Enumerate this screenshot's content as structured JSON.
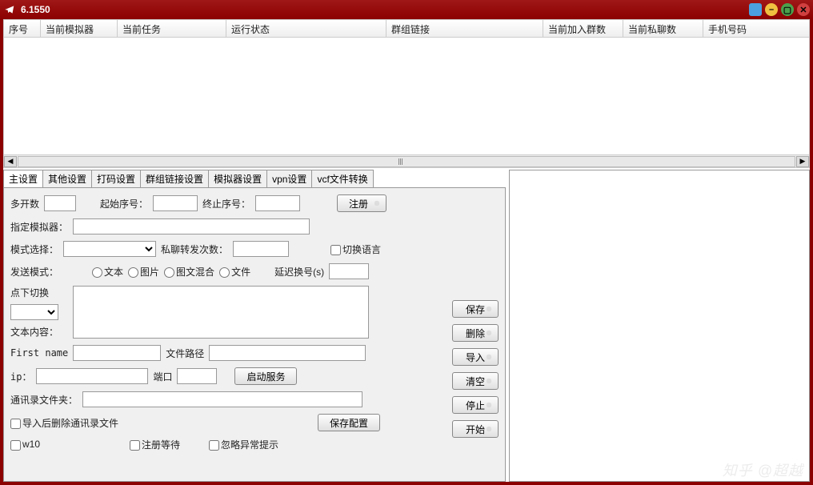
{
  "window": {
    "title": "6.1550"
  },
  "table": {
    "columns": [
      "序号",
      "当前模拟器",
      "当前任务",
      "运行状态",
      "群组链接",
      "当前加入群数",
      "当前私聊数",
      "手机号码"
    ]
  },
  "tabs": [
    "主设置",
    "其他设置",
    "打码设置",
    "群组链接设置",
    "模拟器设置",
    "vpn设置",
    "vcf文件转换"
  ],
  "form": {
    "multiOpen": "多开数",
    "startSeq": "起始序号：",
    "endSeq": "终止序号：",
    "register": "注册",
    "designatedSim": "指定模拟器：",
    "modeSelect": "模式选择：",
    "pmForwardCount": "私聊转发次数：",
    "switchLang": "切换语言",
    "sendMode": "发送模式：",
    "sendOptions": {
      "text": "文本",
      "image": "图片",
      "mixed": "图文混合",
      "file": "文件"
    },
    "delaySwitch": "延迟换号(s)",
    "clickSwitch": "点下切换",
    "textContent": "文本内容：",
    "firstName": "First name",
    "filePath": "文件路径",
    "ip": "ip：",
    "port": "端口",
    "startService": "启动服务",
    "contactsFolder": "通讯录文件夹：",
    "deleteAfterImport": "导入后删除通讯录文件",
    "saveConfig": "保存配置",
    "w10": "w10",
    "waitRegister": "注册等待",
    "ignoreException": "忽略异常提示"
  },
  "sideButtons": {
    "save": "保存",
    "delete": "删除",
    "import": "导入",
    "clear": "清空",
    "stop": "停止",
    "start": "开始"
  },
  "watermark": "知乎 @超越"
}
